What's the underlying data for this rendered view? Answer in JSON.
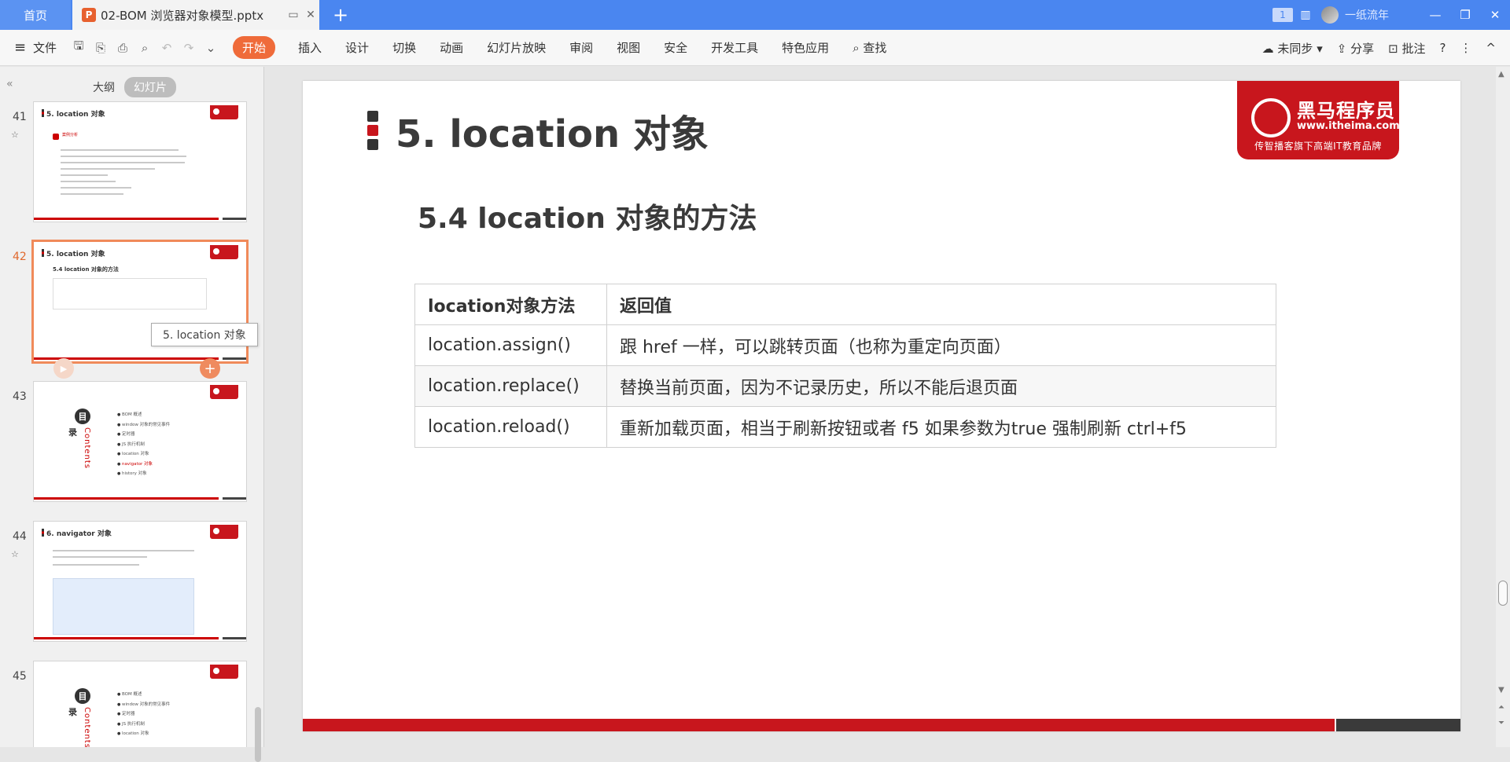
{
  "titlebar": {
    "home_tab": "首页",
    "doc_icon": "P",
    "doc_title": "02-BOM 浏览器对象模型.pptx",
    "new_tab": "+",
    "badge": "1",
    "username": "一纸流年",
    "color": "#4a86f0"
  },
  "ribbon": {
    "file": "文件",
    "start": "开始",
    "items": [
      "插入",
      "设计",
      "切换",
      "动画",
      "幻灯片放映",
      "审阅",
      "视图",
      "安全",
      "开发工具",
      "特色应用"
    ],
    "search": "查找",
    "sync": "未同步",
    "share": "分享",
    "comment": "批注",
    "accent": "#ef6b3a"
  },
  "left_panel": {
    "tab_outline": "大纲",
    "tab_slides": "幻灯片",
    "tooltip": "5. location 对象",
    "slides": [
      {
        "num": "41",
        "title": "5. location 对象",
        "sub": "案例分析"
      },
      {
        "num": "42",
        "title": "5. location 对象",
        "sub": "5.4 location 对象的方法"
      },
      {
        "num": "43",
        "toc_mu": "目",
        "toc_lu": "录",
        "toc_contents": "Contents",
        "toc_items": [
          "BOM 概述",
          "window 对象的常见事件",
          "定时器",
          "JS 执行机制",
          "location 对象",
          "navigator 对象",
          "history 对象"
        ]
      },
      {
        "num": "44",
        "title": "6. navigator 对象"
      },
      {
        "num": "45",
        "toc_mu": "目",
        "toc_lu": "录",
        "toc_contents": "Contents",
        "toc_items": [
          "BOM 概述",
          "window 对象的常见事件",
          "定时器",
          "JS 执行机制",
          "location 对象"
        ]
      }
    ]
  },
  "slide": {
    "title": "5. location 对象",
    "subtitle": "5.4 location 对象的方法",
    "brand_name": "黑马程序员",
    "brand_url": "www.itheima.com",
    "brand_slogan": "传智播客旗下高端IT教育品牌",
    "brand_color": "#c8161d",
    "table": {
      "headers": [
        "location对象方法",
        "返回值"
      ],
      "rows": [
        [
          "location.assign()",
          "跟 href 一样，可以跳转页面（也称为重定向页面）"
        ],
        [
          "location.replace()",
          "替换当前页面，因为不记录历史，所以不能后退页面"
        ],
        [
          "location.reload()",
          "重新加载页面，相当于刷新按钮或者 f5 如果参数为true 强制刷新 ctrl+f5"
        ]
      ]
    }
  }
}
